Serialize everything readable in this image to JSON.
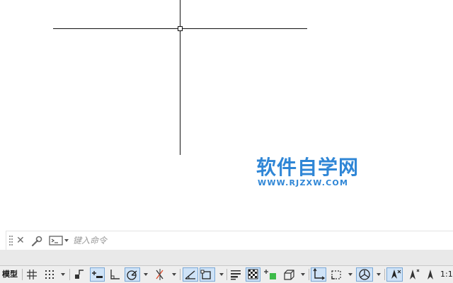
{
  "watermark": {
    "title": "软件自学网",
    "url": "WWW.RJZXW.COM",
    "color": "#2f86d6"
  },
  "command_line": {
    "placeholder": "键入命令",
    "icons": [
      "grip-icon",
      "close-icon",
      "wrench-icon",
      "command-prompt-icon"
    ]
  },
  "status_bar": {
    "model_tab": "模型",
    "scale": "1:1",
    "active_color": "#cfe3f7",
    "icons": [
      "grid-icon",
      "snap-icon",
      "infer-constraints-icon",
      "dynamic-input-icon",
      "ortho-icon",
      "polar-tracking-icon",
      "isodraft-icon",
      "object-snap-tracking-icon",
      "object-snap-icon",
      "lineweight-icon",
      "transparency-icon",
      "selection-cycling-icon",
      "3d-object-snap-icon",
      "dynamic-ucs-icon",
      "selection-filter-icon",
      "gizmo-icon",
      "annotation-visibility-icon",
      "auto-scale-icon",
      "annotation-scale-icon"
    ]
  }
}
